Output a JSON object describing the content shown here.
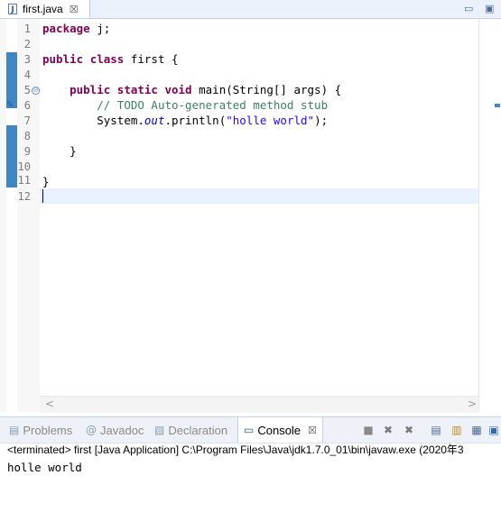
{
  "editor": {
    "tab_label": "first.java",
    "file_icon": "java-file-icon",
    "close_glyph": "☒",
    "minimize_glyph": "▭",
    "maximize_glyph": "▣",
    "line_numbers": [
      "1",
      "2",
      "3",
      "4",
      "5",
      "6",
      "7",
      "8",
      "9",
      "10",
      "11",
      "12"
    ],
    "code": {
      "l1_kw": "package",
      "l1_rest": " j;",
      "l3_kw1": "public",
      "l3_kw2": "class",
      "l3_rest": " first {",
      "l5_indent": "    ",
      "l5_kw1": "public",
      "l5_kw2": "static",
      "l5_kw3": "void",
      "l5_rest": " main(String[] args) {",
      "l6_indent": "        ",
      "l6_comment": "// TODO Auto-generated method stub",
      "l7_indent": "        ",
      "l7_pre": "System.",
      "l7_field": "out",
      "l7_mid": ".println(",
      "l7_string": "\"holle world\"",
      "l7_post": ");",
      "l9": "    }",
      "l11": "}"
    },
    "fold_glyph": "⊖",
    "task_glyph": "✎",
    "scroll_left": "<",
    "scroll_right": ">"
  },
  "views": {
    "tabs": [
      {
        "label": "Problems",
        "icon": "problems-icon",
        "glyph": "▤"
      },
      {
        "label": "Javadoc",
        "icon": "javadoc-icon",
        "glyph": "@"
      },
      {
        "label": "Declaration",
        "icon": "declaration-icon",
        "glyph": "▧"
      },
      {
        "label": "Console",
        "icon": "console-icon",
        "glyph": "▭"
      }
    ],
    "close_glyph": "☒",
    "toolbar": [
      {
        "name": "terminate-icon",
        "glyph": "■",
        "color": "#8a8a8a"
      },
      {
        "name": "remove-launch-icon",
        "glyph": "✖",
        "color": "#7a7a7a"
      },
      {
        "name": "remove-all-launches-icon",
        "glyph": "✖",
        "color": "#7a7a7a"
      },
      {
        "name": "clear-console-icon",
        "glyph": "▤",
        "color": "#4a6a98"
      },
      {
        "name": "scroll-lock-icon",
        "glyph": "▥",
        "color": "#c08a1a"
      },
      {
        "name": "word-wrap-icon",
        "glyph": "▦",
        "color": "#4a6a98"
      },
      {
        "name": "pin-console-icon",
        "glyph": "▣",
        "color": "#2c6aa8"
      }
    ]
  },
  "console": {
    "header": "<terminated> first [Java Application] C:\\Program Files\\Java\\jdk1.7.0_01\\bin\\javaw.exe (2020年3",
    "output": "holle world"
  },
  "colors": {
    "keyword": "#7f0055",
    "comment": "#3f7f5f",
    "string": "#2a00ff",
    "field": "#0000c0",
    "change_bar": "#3f86c2",
    "current_line": "#e8f2fe"
  }
}
